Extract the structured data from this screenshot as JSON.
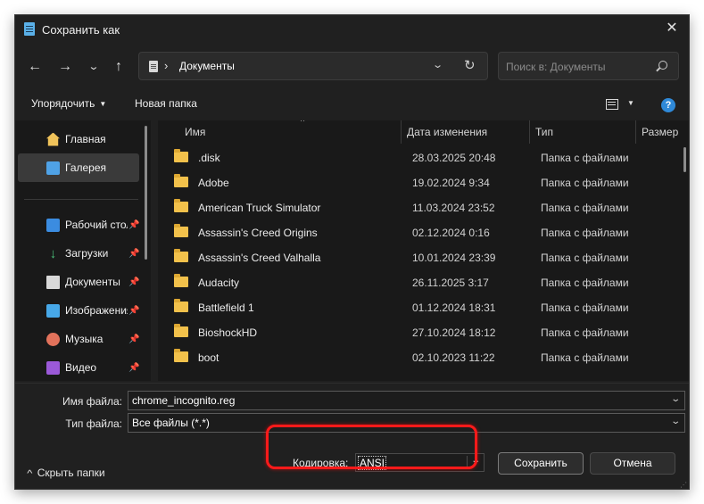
{
  "window": {
    "title": "Сохранить как"
  },
  "nav": {
    "breadcrumb_separator": "›",
    "address": "Документы",
    "search_placeholder": "Поиск в: Документы"
  },
  "toolbar": {
    "organize_label": "Упорядочить",
    "new_folder_label": "Новая папка",
    "help_label": "?"
  },
  "sidebar": {
    "items": [
      {
        "label": "Главная",
        "icon": "home-icon",
        "pinned": false
      },
      {
        "label": "Галерея",
        "icon": "gallery-icon",
        "pinned": false,
        "selected": true
      },
      {
        "label": "Рабочий стол",
        "icon": "desktop-icon",
        "pinned": true
      },
      {
        "label": "Загрузки",
        "icon": "download-icon",
        "pinned": true
      },
      {
        "label": "Документы",
        "icon": "documents-icon",
        "pinned": true
      },
      {
        "label": "Изображения",
        "icon": "images-icon",
        "pinned": true
      },
      {
        "label": "Музыка",
        "icon": "music-icon",
        "pinned": true
      },
      {
        "label": "Видео",
        "icon": "video-icon",
        "pinned": true
      }
    ]
  },
  "files": {
    "columns": {
      "name": "Имя",
      "date": "Дата изменения",
      "type": "Тип",
      "size": "Размер"
    },
    "rows": [
      {
        "name": ".disk",
        "date": "28.03.2025 20:48",
        "type": "Папка с файлами"
      },
      {
        "name": "Adobe",
        "date": "19.02.2024 9:34",
        "type": "Папка с файлами"
      },
      {
        "name": "American Truck Simulator",
        "date": "11.03.2024 23:52",
        "type": "Папка с файлами"
      },
      {
        "name": "Assassin's Creed Origins",
        "date": "02.12.2024 0:16",
        "type": "Папка с файлами"
      },
      {
        "name": "Assassin's Creed Valhalla",
        "date": "10.01.2024 23:39",
        "type": "Папка с файлами"
      },
      {
        "name": "Audacity",
        "date": "26.11.2025 3:17",
        "type": "Папка с файлами"
      },
      {
        "name": "Battlefield 1",
        "date": "01.12.2024 18:31",
        "type": "Папка с файлами"
      },
      {
        "name": "BioshockHD",
        "date": "27.10.2024 18:12",
        "type": "Папка с файлами"
      },
      {
        "name": "boot",
        "date": "02.10.2023 11:22",
        "type": "Папка с файлами"
      }
    ]
  },
  "footer": {
    "filename_label": "Имя файла:",
    "filename_value": "chrome_incognito.reg",
    "filetype_label": "Тип файла:",
    "filetype_value": "Все файлы  (*.*)",
    "hide_folders_label": "Скрыть папки",
    "encoding_label": "Кодировка:",
    "encoding_value": "ANSI",
    "save_label": "Сохранить",
    "cancel_label": "Отмена"
  },
  "colors": {
    "window_bg": "#202020",
    "pane_bg": "#191919",
    "folder": "#f2c14b",
    "accent": "#2f89d8",
    "highlight": "#ff1a1a"
  }
}
